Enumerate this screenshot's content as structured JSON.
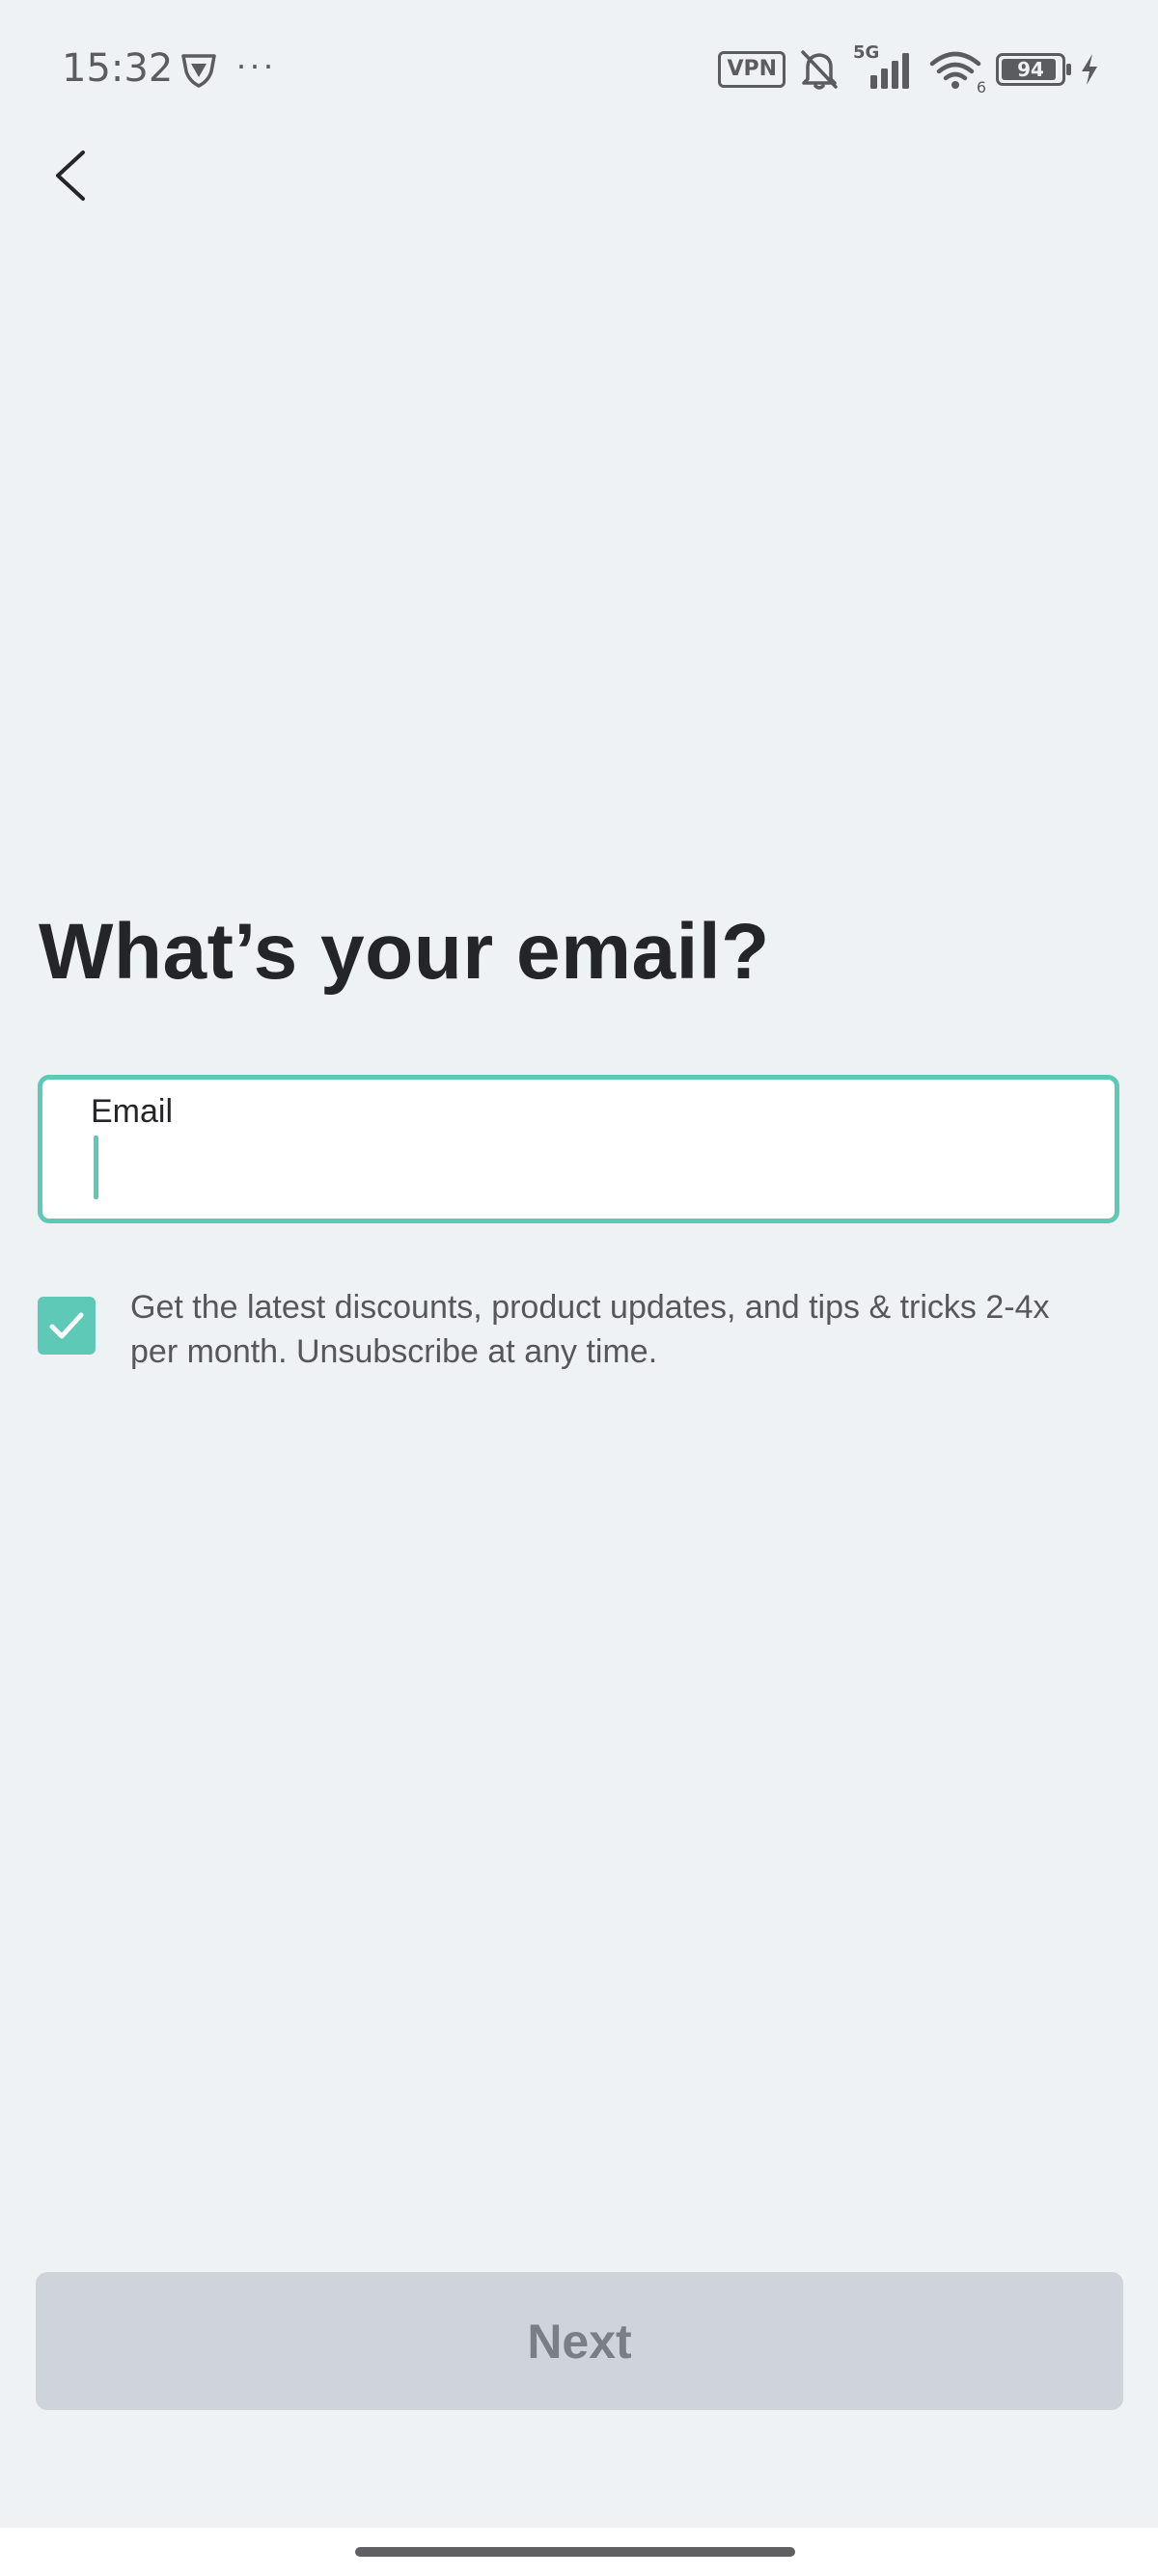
{
  "status_bar": {
    "time": "15:32",
    "vpn_label": "VPN",
    "network_label": "5G",
    "wifi_label": "6",
    "battery_level": "94",
    "battery_fraction": 0.94,
    "icons": [
      "shield-icon",
      "more-dots-icon",
      "vpn-icon",
      "bell-muted-icon",
      "signal-icon",
      "wifi-icon",
      "battery-icon",
      "charging-icon"
    ]
  },
  "header": {
    "back_icon": "chevron-left-icon"
  },
  "main": {
    "title": "What’s your email?",
    "email_field": {
      "label": "Email",
      "value": "",
      "placeholder": ""
    },
    "consent": {
      "checked": true,
      "text": "Get the latest discounts, product updates, and tips & tricks 2-4x per month. Unsubscribe at any time."
    }
  },
  "footer": {
    "next_label": "Next",
    "next_disabled": true
  },
  "colors": {
    "accent": "#5ec9b6",
    "background": "#eff2f5",
    "title_text": "#232528",
    "disabled_button_bg": "#cfd4db",
    "disabled_button_text": "#7a7f87"
  }
}
